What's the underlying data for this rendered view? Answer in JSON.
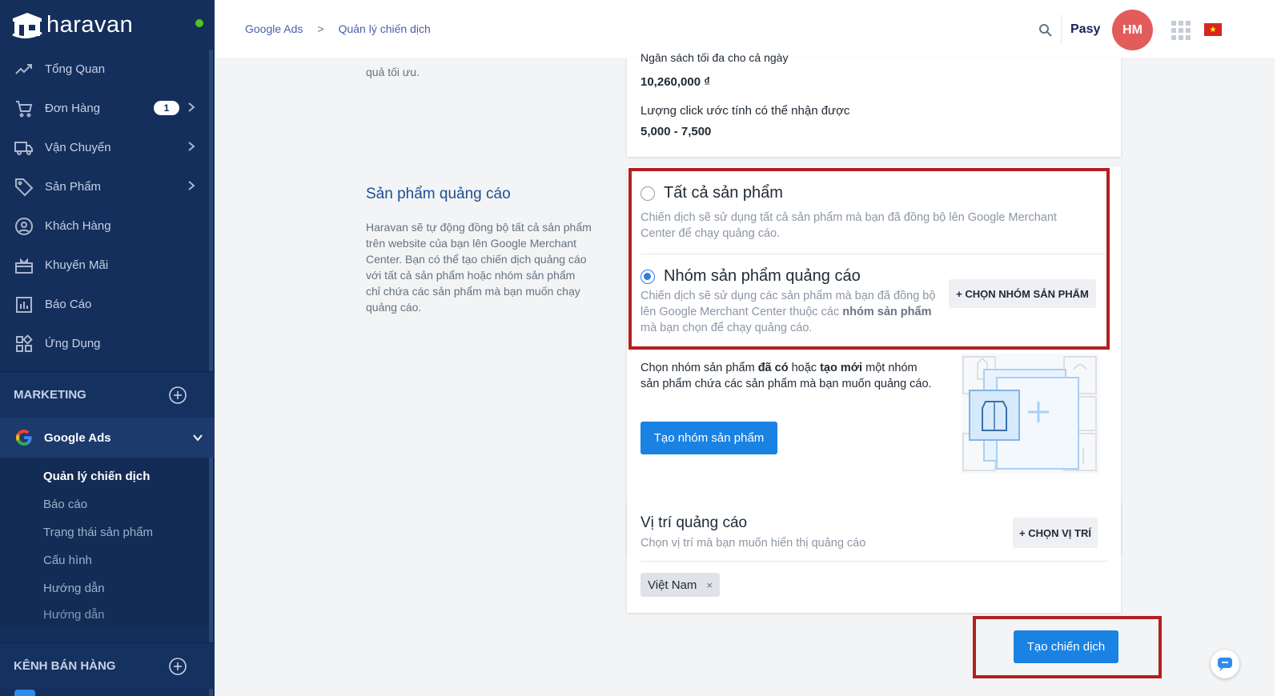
{
  "brand": {
    "name": "haravan"
  },
  "sidebar": {
    "items": [
      {
        "label": "Tổng Quan",
        "icon": "trend-icon"
      },
      {
        "label": "Đơn Hàng",
        "icon": "cart-icon",
        "badge": "1",
        "has_children": true
      },
      {
        "label": "Vận Chuyển",
        "icon": "truck-icon",
        "has_children": true
      },
      {
        "label": "Sản Phẩm",
        "icon": "tag-icon",
        "has_children": true
      },
      {
        "label": "Khách Hàng",
        "icon": "user-circle-icon"
      },
      {
        "label": "Khuyến Mãi",
        "icon": "gift-icon"
      },
      {
        "label": "Báo Cáo",
        "icon": "bar-chart-icon"
      },
      {
        "label": "Ứng Dụng",
        "icon": "apps-icon"
      }
    ],
    "marketing_label": "MARKETING",
    "google_ads_label": "Google Ads",
    "sub_items": [
      {
        "label": "Quản lý chiến dịch",
        "active": true
      },
      {
        "label": "Báo cáo"
      },
      {
        "label": "Trạng thái sản phẩm"
      },
      {
        "label": "Cấu hình"
      },
      {
        "label": "Hướng dẫn"
      },
      {
        "label": "Hướng dẫn"
      }
    ],
    "sales_channel_label": "KÊNH BÁN HÀNG"
  },
  "header": {
    "breadcrumb": [
      "Google Ads",
      "Quản lý chiến dịch"
    ],
    "user_name": "Pasy",
    "avatar_initials": "HM"
  },
  "main": {
    "left_top_desc": "quả tối ưu.",
    "products_section": {
      "title": "Sản phẩm quảng cáo",
      "description": "Haravan sẽ tự động đồng bộ tất cả sản phẩm trên website của bạn lên Google Merchant Center. Bạn có thể tạo chiến dịch quảng cáo với tất cả sản phẩm hoặc nhóm sản phẩm chỉ chứa các sản phẩm mà bạn muốn chạy quảng cáo."
    },
    "budget": {
      "cut_label": "Ngân sách tối đa cho cả ngày",
      "value": "10,260,000 ₫",
      "clicks_label": "Lượng click ước tính có thể nhận được",
      "clicks_value": "5,000 - 7,500"
    },
    "option_all": {
      "label": "Tất cả sản phẩm",
      "description": "Chiến dịch sẽ sử dụng tất cả sản phẩm mà bạn đã đồng bộ lên Google Merchant Center để chạy quảng cáo.",
      "checked": false
    },
    "option_group": {
      "label": "Nhóm sản phẩm quảng cáo",
      "desc_part1": "Chiến dịch sẽ sử dụng các sản phẩm mà bạn đã đồng bộ lên Google Merchant Center thuộc các ",
      "desc_bold": "nhóm sản phẩm",
      "desc_part2": " mà bạn chọn để chạy quảng cáo.",
      "checked": true,
      "choose_button": "+ CHỌN NHÓM SẢN PHẨM"
    },
    "group_help": {
      "part1": "Chọn nhóm sản phẩm ",
      "bold1": "đã có",
      "part2": " hoặc ",
      "bold2": "tạo mới",
      "part3": " một nhóm sản phẩm chứa các sản phẩm mà bạn muốn quảng cáo.",
      "create_button": "Tạo nhóm sản phẩm"
    },
    "location": {
      "title": "Vị trí quảng cáo",
      "subtitle": "Chọn vị trí mà bạn muốn hiển thị quảng cáo",
      "choose_button": "+ CHỌN VỊ TRÍ",
      "tag": "Việt Nam",
      "tag_remove": "×"
    },
    "create_campaign_button": "Tạo chiến dịch"
  },
  "colors": {
    "sidebar": "#142f5c",
    "primary": "#1a82e2",
    "highlight": "#b41f1f",
    "avatar": "#e25c5c"
  }
}
